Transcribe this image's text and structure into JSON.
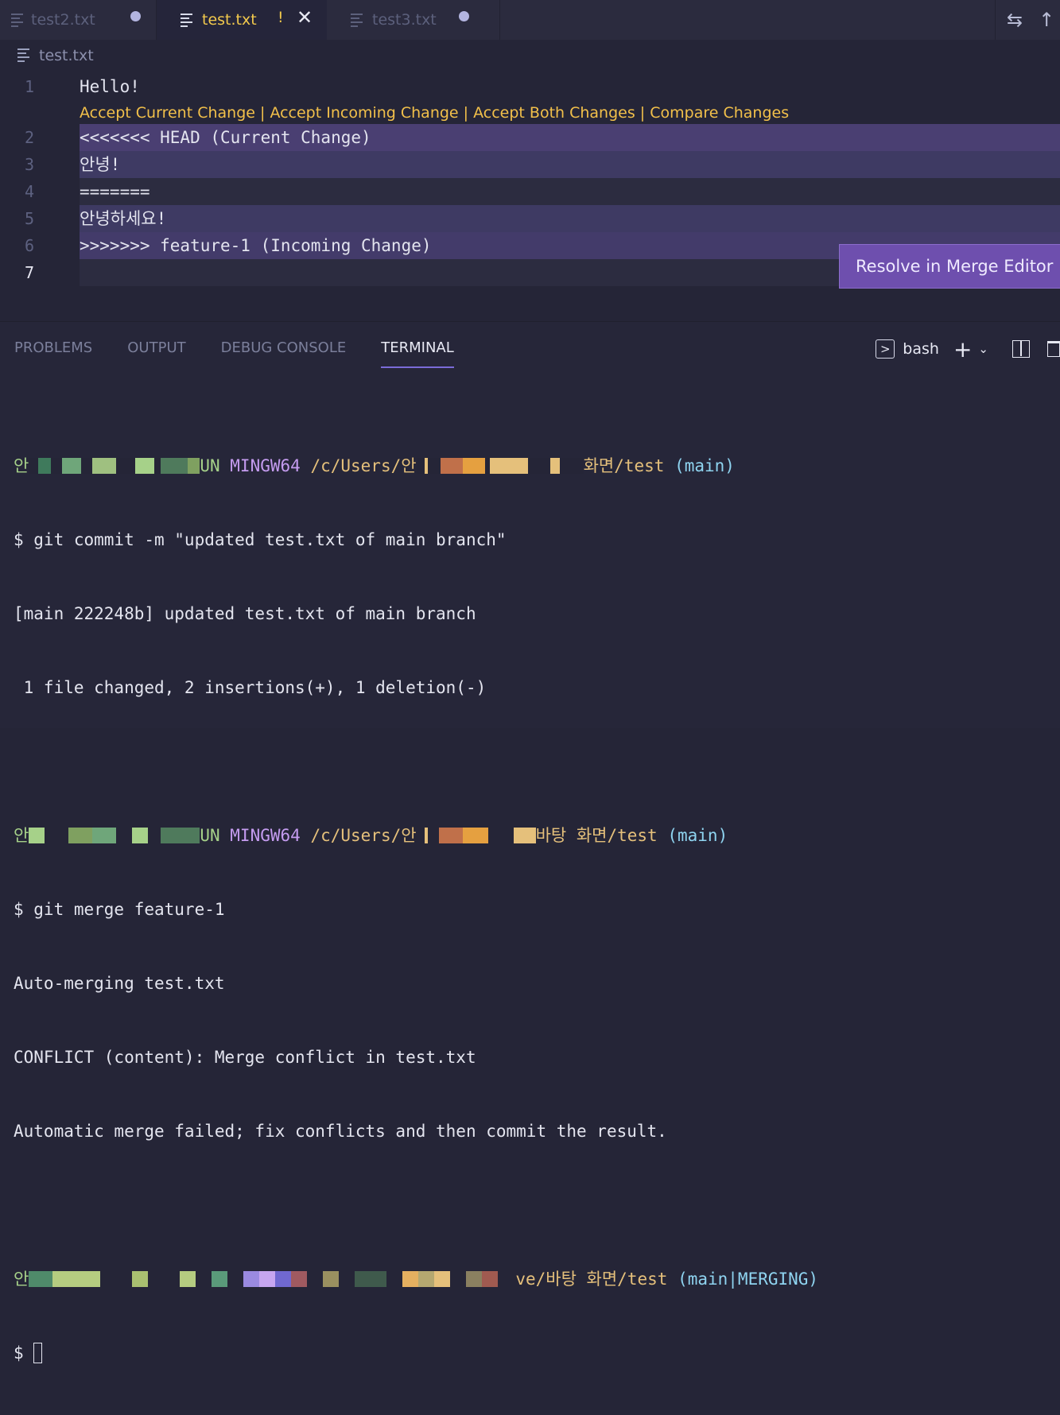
{
  "tabs": [
    {
      "label": "test2.txt",
      "state": "modified"
    },
    {
      "label": "test.txt",
      "state": "conflict",
      "marker": "!"
    },
    {
      "label": "test3.txt",
      "state": "modified"
    }
  ],
  "breadcrumb": {
    "file": "test.txt"
  },
  "editor": {
    "codelens": {
      "accept_current": "Accept Current Change",
      "accept_incoming": "Accept Incoming Change",
      "accept_both": "Accept Both Changes",
      "compare": "Compare Changes",
      "separator": " | "
    },
    "lines": [
      {
        "num": "1",
        "text": "Hello!"
      },
      {
        "num": "2",
        "text": "<<<<<<< HEAD (Current Change)"
      },
      {
        "num": "3",
        "text": "안녕!"
      },
      {
        "num": "4",
        "text": "======="
      },
      {
        "num": "5",
        "text": "안녕하세요!"
      },
      {
        "num": "6",
        "text": ">>>>>>> feature-1 (Incoming Change)"
      },
      {
        "num": "7",
        "text": ""
      }
    ],
    "resolve_button": "Resolve in Merge Editor"
  },
  "panel": {
    "tabs": [
      "PROBLEMS",
      "OUTPUT",
      "DEBUG CONSOLE",
      "TERMINAL"
    ],
    "active_tab": "TERMINAL",
    "terminal_name": "bash"
  },
  "terminal": {
    "prompt1": {
      "user_start": "안",
      "user_end": "UN",
      "host": "MINGW64",
      "path_start": "/c/Users/안",
      "path_end": "화면/test",
      "branch": "(main)"
    },
    "cmd1": "$ git commit -m \"updated test.txt of main branch\"",
    "out1": "[main 222248b] updated test.txt of main branch",
    "out2": " 1 file changed, 2 insertions(+), 1 deletion(-)",
    "prompt2": {
      "user_start": "안",
      "user_end": "UN",
      "host": "MINGW64",
      "path_start": "/c/Users/안",
      "path_end": "바탕 화면/test",
      "branch": "(main)"
    },
    "cmd2": "$ git merge feature-1",
    "out3": "Auto-merging test.txt",
    "out4": "CONFLICT (content): Merge conflict in test.txt",
    "out5": "Automatic merge failed; fix conflicts and then commit the result.",
    "prompt3": {
      "user_start": "안",
      "path_end": "ve/바탕 화면/test",
      "branch": "(main|MERGING)"
    },
    "cmd3": "$ "
  },
  "colors": {
    "accent": "#7a6bd8",
    "warning": "#f2c04a",
    "merge_button": "#6e4fae"
  },
  "icons": [
    "file-lines-icon",
    "modified-dot-icon",
    "close-icon",
    "source-control-compare-icon",
    "arrow-up-icon",
    "terminal-icon",
    "plus-icon",
    "chevron-down-icon",
    "split-icon",
    "trash-icon"
  ]
}
